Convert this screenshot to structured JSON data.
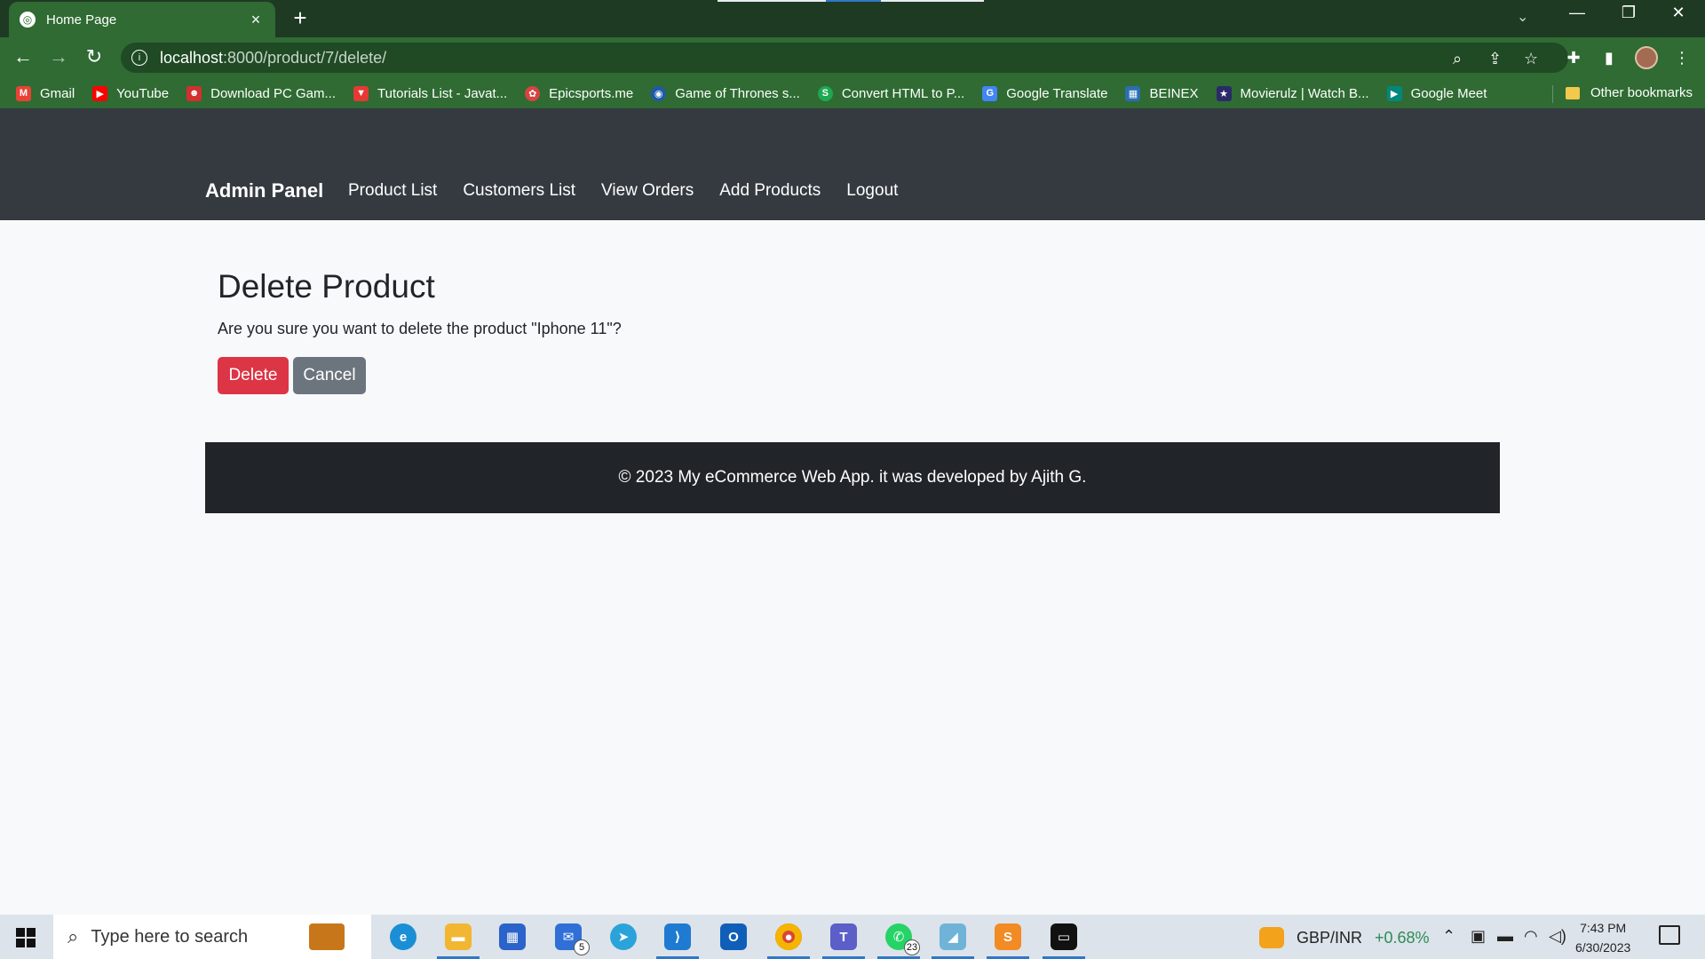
{
  "browser": {
    "tab_title": "Home Page",
    "tab_close": "×",
    "new_tab": "+",
    "url_host": "localhost",
    "url_path": ":8000/product/7/delete/",
    "window_minimize": "—",
    "window_restore": "❐",
    "window_close": "✕",
    "bookmarks": [
      {
        "label": "Gmail",
        "icon": "gmail-icon",
        "color": "#e94235",
        "glyph": "M"
      },
      {
        "label": "YouTube",
        "icon": "youtube-icon",
        "color": "#ff0000",
        "glyph": "▶"
      },
      {
        "label": "Download PC Gam...",
        "icon": "game-icon",
        "color": "#d32f2f",
        "glyph": "☻"
      },
      {
        "label": "Tutorials List - Javat...",
        "icon": "javatpoint-icon",
        "color": "#e53935",
        "glyph": "▼"
      },
      {
        "label": "Epicsports.me",
        "icon": "epicsports-icon",
        "color": "#d84343",
        "glyph": "✿"
      },
      {
        "label": "Game of Thrones s...",
        "icon": "globe-icon",
        "color": "#1e5aa8",
        "glyph": "◉"
      },
      {
        "label": "Convert HTML to P...",
        "icon": "convert-icon",
        "color": "#1da851",
        "glyph": "S"
      },
      {
        "label": "Google Translate",
        "icon": "translate-icon",
        "color": "#4285f4",
        "glyph": "G"
      },
      {
        "label": "BEINEX",
        "icon": "beinex-icon",
        "color": "#2a6fb0",
        "glyph": "▦"
      },
      {
        "label": "Movierulz | Watch B...",
        "icon": "movierulz-icon",
        "color": "#2a2a6a",
        "glyph": "★"
      },
      {
        "label": "Google Meet",
        "icon": "meet-icon",
        "color": "#00897b",
        "glyph": "▶"
      }
    ],
    "other_bookmarks": "Other bookmarks"
  },
  "navbar": {
    "brand": "Admin Panel",
    "links": [
      "Product List",
      "Customers List",
      "View Orders",
      "Add Products",
      "Logout"
    ]
  },
  "main": {
    "heading": "Delete Product",
    "message": "Are you sure you want to delete the product \"Iphone 11\"?",
    "delete_label": "Delete",
    "cancel_label": "Cancel"
  },
  "footer": {
    "text": "© 2023 My eCommerce Web App. it was developed by Ajith G."
  },
  "taskbar": {
    "search_placeholder": "Type here to search",
    "mail_badge": "5",
    "whatsapp_badge": "23",
    "ticker_symbol": "GBP/INR",
    "ticker_change": "+0.68%",
    "time": "7:43 PM",
    "date": "6/30/2023"
  },
  "colors": {
    "navbar_bg": "#343a40",
    "footer_bg": "#212529",
    "danger": "#dc3545",
    "secondary": "#6c757d",
    "browser_theme": "#2f6b33"
  }
}
